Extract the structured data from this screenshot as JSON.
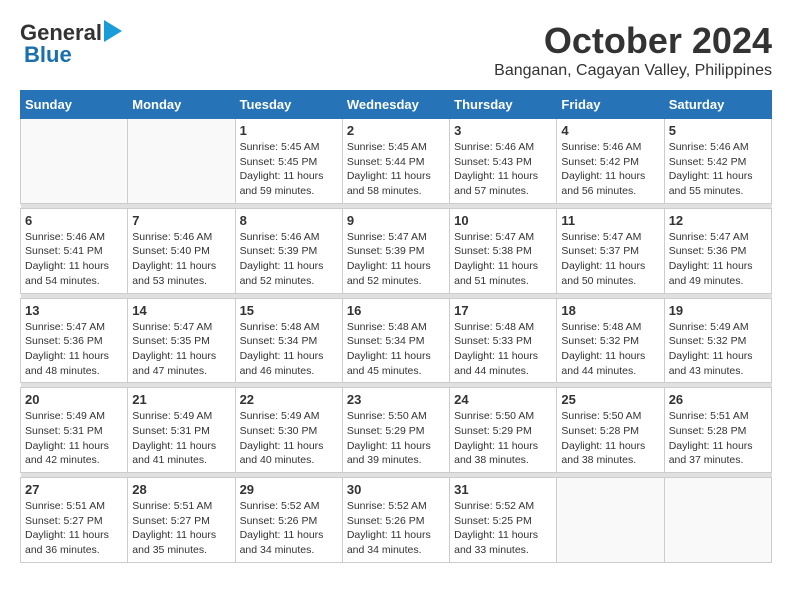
{
  "header": {
    "logo_line1": "General",
    "logo_line2": "Blue",
    "main_title": "October 2024",
    "subtitle": "Banganan, Cagayan Valley, Philippines"
  },
  "days_of_week": [
    "Sunday",
    "Monday",
    "Tuesday",
    "Wednesday",
    "Thursday",
    "Friday",
    "Saturday"
  ],
  "weeks": [
    [
      {
        "day": "",
        "sunrise": "",
        "sunset": "",
        "daylight": ""
      },
      {
        "day": "",
        "sunrise": "",
        "sunset": "",
        "daylight": ""
      },
      {
        "day": "1",
        "sunrise": "Sunrise: 5:45 AM",
        "sunset": "Sunset: 5:45 PM",
        "daylight": "Daylight: 11 hours and 59 minutes."
      },
      {
        "day": "2",
        "sunrise": "Sunrise: 5:45 AM",
        "sunset": "Sunset: 5:44 PM",
        "daylight": "Daylight: 11 hours and 58 minutes."
      },
      {
        "day": "3",
        "sunrise": "Sunrise: 5:46 AM",
        "sunset": "Sunset: 5:43 PM",
        "daylight": "Daylight: 11 hours and 57 minutes."
      },
      {
        "day": "4",
        "sunrise": "Sunrise: 5:46 AM",
        "sunset": "Sunset: 5:42 PM",
        "daylight": "Daylight: 11 hours and 56 minutes."
      },
      {
        "day": "5",
        "sunrise": "Sunrise: 5:46 AM",
        "sunset": "Sunset: 5:42 PM",
        "daylight": "Daylight: 11 hours and 55 minutes."
      }
    ],
    [
      {
        "day": "6",
        "sunrise": "Sunrise: 5:46 AM",
        "sunset": "Sunset: 5:41 PM",
        "daylight": "Daylight: 11 hours and 54 minutes."
      },
      {
        "day": "7",
        "sunrise": "Sunrise: 5:46 AM",
        "sunset": "Sunset: 5:40 PM",
        "daylight": "Daylight: 11 hours and 53 minutes."
      },
      {
        "day": "8",
        "sunrise": "Sunrise: 5:46 AM",
        "sunset": "Sunset: 5:39 PM",
        "daylight": "Daylight: 11 hours and 52 minutes."
      },
      {
        "day": "9",
        "sunrise": "Sunrise: 5:47 AM",
        "sunset": "Sunset: 5:39 PM",
        "daylight": "Daylight: 11 hours and 52 minutes."
      },
      {
        "day": "10",
        "sunrise": "Sunrise: 5:47 AM",
        "sunset": "Sunset: 5:38 PM",
        "daylight": "Daylight: 11 hours and 51 minutes."
      },
      {
        "day": "11",
        "sunrise": "Sunrise: 5:47 AM",
        "sunset": "Sunset: 5:37 PM",
        "daylight": "Daylight: 11 hours and 50 minutes."
      },
      {
        "day": "12",
        "sunrise": "Sunrise: 5:47 AM",
        "sunset": "Sunset: 5:36 PM",
        "daylight": "Daylight: 11 hours and 49 minutes."
      }
    ],
    [
      {
        "day": "13",
        "sunrise": "Sunrise: 5:47 AM",
        "sunset": "Sunset: 5:36 PM",
        "daylight": "Daylight: 11 hours and 48 minutes."
      },
      {
        "day": "14",
        "sunrise": "Sunrise: 5:47 AM",
        "sunset": "Sunset: 5:35 PM",
        "daylight": "Daylight: 11 hours and 47 minutes."
      },
      {
        "day": "15",
        "sunrise": "Sunrise: 5:48 AM",
        "sunset": "Sunset: 5:34 PM",
        "daylight": "Daylight: 11 hours and 46 minutes."
      },
      {
        "day": "16",
        "sunrise": "Sunrise: 5:48 AM",
        "sunset": "Sunset: 5:34 PM",
        "daylight": "Daylight: 11 hours and 45 minutes."
      },
      {
        "day": "17",
        "sunrise": "Sunrise: 5:48 AM",
        "sunset": "Sunset: 5:33 PM",
        "daylight": "Daylight: 11 hours and 44 minutes."
      },
      {
        "day": "18",
        "sunrise": "Sunrise: 5:48 AM",
        "sunset": "Sunset: 5:32 PM",
        "daylight": "Daylight: 11 hours and 44 minutes."
      },
      {
        "day": "19",
        "sunrise": "Sunrise: 5:49 AM",
        "sunset": "Sunset: 5:32 PM",
        "daylight": "Daylight: 11 hours and 43 minutes."
      }
    ],
    [
      {
        "day": "20",
        "sunrise": "Sunrise: 5:49 AM",
        "sunset": "Sunset: 5:31 PM",
        "daylight": "Daylight: 11 hours and 42 minutes."
      },
      {
        "day": "21",
        "sunrise": "Sunrise: 5:49 AM",
        "sunset": "Sunset: 5:31 PM",
        "daylight": "Daylight: 11 hours and 41 minutes."
      },
      {
        "day": "22",
        "sunrise": "Sunrise: 5:49 AM",
        "sunset": "Sunset: 5:30 PM",
        "daylight": "Daylight: 11 hours and 40 minutes."
      },
      {
        "day": "23",
        "sunrise": "Sunrise: 5:50 AM",
        "sunset": "Sunset: 5:29 PM",
        "daylight": "Daylight: 11 hours and 39 minutes."
      },
      {
        "day": "24",
        "sunrise": "Sunrise: 5:50 AM",
        "sunset": "Sunset: 5:29 PM",
        "daylight": "Daylight: 11 hours and 38 minutes."
      },
      {
        "day": "25",
        "sunrise": "Sunrise: 5:50 AM",
        "sunset": "Sunset: 5:28 PM",
        "daylight": "Daylight: 11 hours and 38 minutes."
      },
      {
        "day": "26",
        "sunrise": "Sunrise: 5:51 AM",
        "sunset": "Sunset: 5:28 PM",
        "daylight": "Daylight: 11 hours and 37 minutes."
      }
    ],
    [
      {
        "day": "27",
        "sunrise": "Sunrise: 5:51 AM",
        "sunset": "Sunset: 5:27 PM",
        "daylight": "Daylight: 11 hours and 36 minutes."
      },
      {
        "day": "28",
        "sunrise": "Sunrise: 5:51 AM",
        "sunset": "Sunset: 5:27 PM",
        "daylight": "Daylight: 11 hours and 35 minutes."
      },
      {
        "day": "29",
        "sunrise": "Sunrise: 5:52 AM",
        "sunset": "Sunset: 5:26 PM",
        "daylight": "Daylight: 11 hours and 34 minutes."
      },
      {
        "day": "30",
        "sunrise": "Sunrise: 5:52 AM",
        "sunset": "Sunset: 5:26 PM",
        "daylight": "Daylight: 11 hours and 34 minutes."
      },
      {
        "day": "31",
        "sunrise": "Sunrise: 5:52 AM",
        "sunset": "Sunset: 5:25 PM",
        "daylight": "Daylight: 11 hours and 33 minutes."
      },
      {
        "day": "",
        "sunrise": "",
        "sunset": "",
        "daylight": ""
      },
      {
        "day": "",
        "sunrise": "",
        "sunset": "",
        "daylight": ""
      }
    ]
  ]
}
